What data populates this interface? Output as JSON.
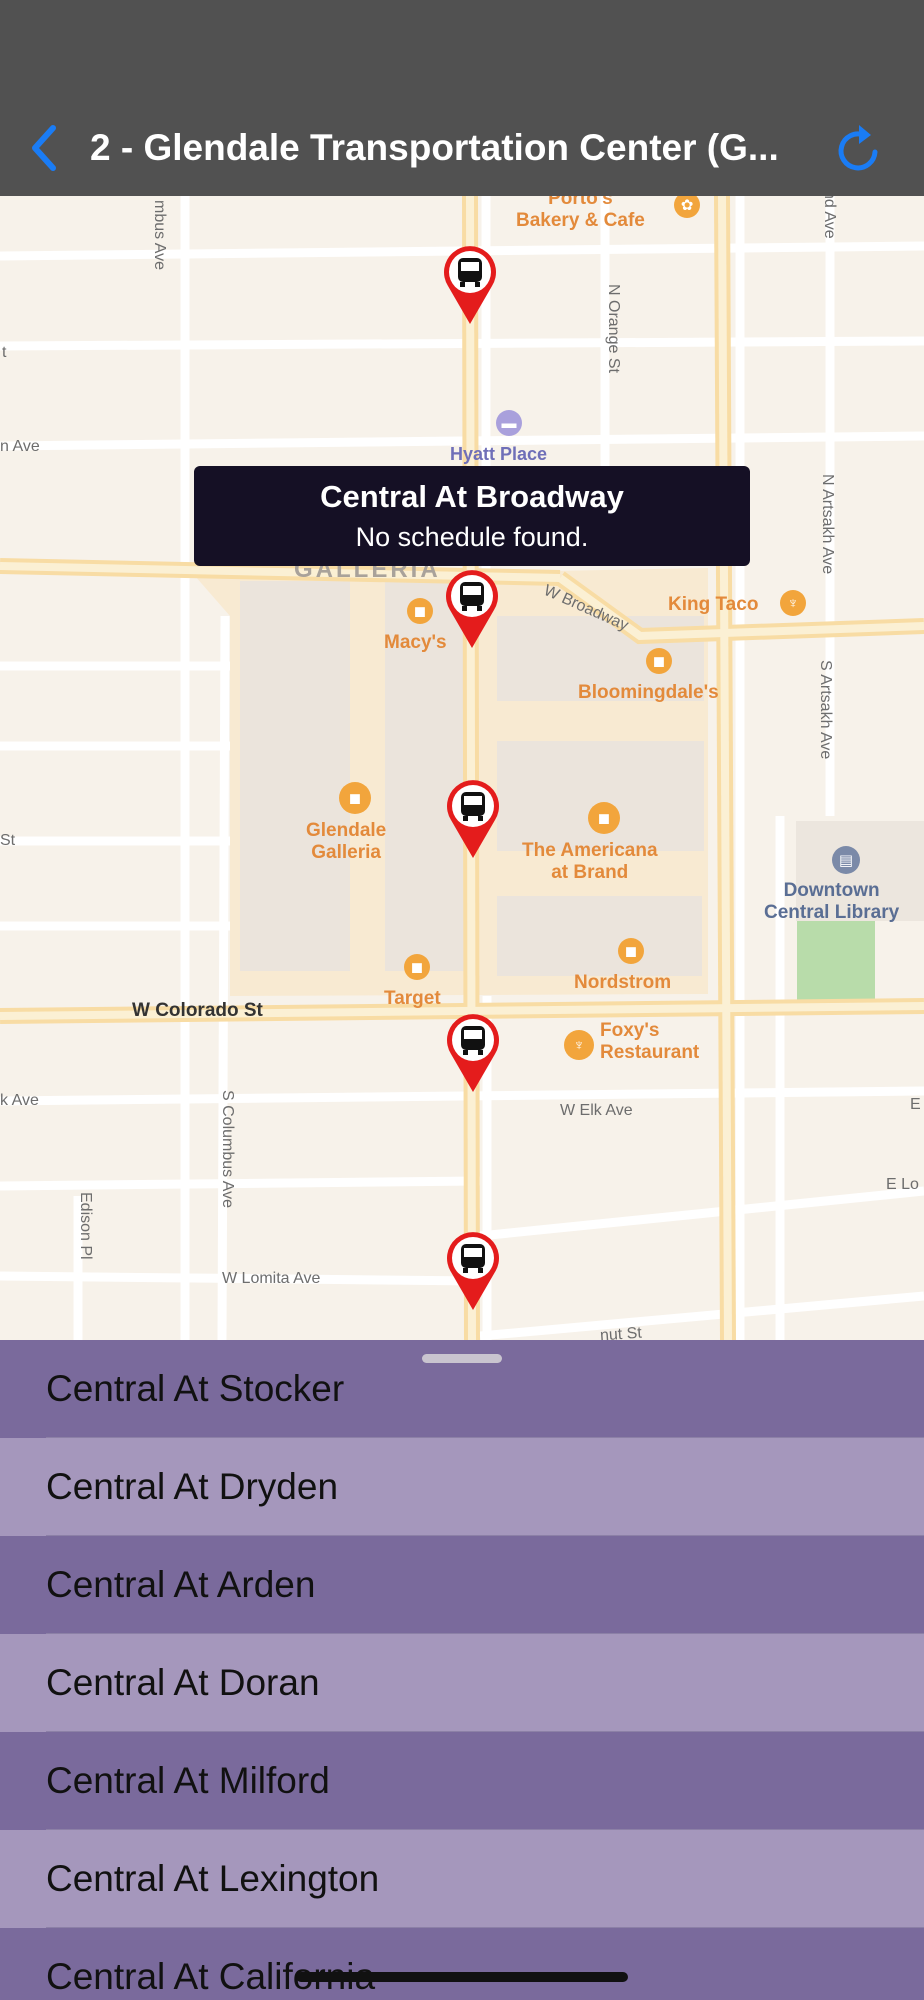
{
  "nav": {
    "title": "2 - Glendale Transportation Center (G...",
    "back_icon": "chevron-left-icon",
    "refresh_icon": "refresh-icon",
    "accent_color": "#1a7cf5"
  },
  "map": {
    "labels": {
      "portos": "Porto's\nBakery & Cafe",
      "hyatt": "Hyatt Place",
      "galleria_district": "GALLERIA",
      "macys": "Macy's",
      "king_taco": "King Taco",
      "bloomingdales": "Bloomingdale's",
      "glendale_galleria": "Glendale\nGalleria",
      "americana": "The Americana\nat Brand",
      "downtown_library": "Downtown\nCentral Library",
      "nordstrom": "Nordstrom",
      "target": "Target",
      "foxys": "Foxy's\nRestaurant",
      "w_colorado": "W Colorado St",
      "w_elk": "W Elk Ave",
      "w_lomita": "W Lomita Ave",
      "w_broadway": "W Broadway",
      "n_orange": "N Orange St",
      "n_artsakh": "N Artsakh Ave",
      "s_artsakh": "S Artsakh Ave",
      "s_columbus": "S Columbus Ave",
      "edison": "Edison Pl",
      "columbus_top": "mbus Ave",
      "nd_ave": "nd Ave",
      "n_ave": "n Ave",
      "k_ave": "k Ave",
      "st_left": "St",
      "t_left": "t",
      "e_lo": "E Lo",
      "e_right": "E",
      "nut_st": "nut St"
    },
    "callout": {
      "title": "Central At Broadway",
      "subtitle": "No schedule found."
    },
    "pin_icon": "bus-stop-pin-icon"
  },
  "stops": [
    "Central At Stocker",
    "Central At Dryden",
    "Central At Arden",
    "Central At Doran",
    "Central At Milford",
    "Central At Lexington",
    "Central At California"
  ]
}
